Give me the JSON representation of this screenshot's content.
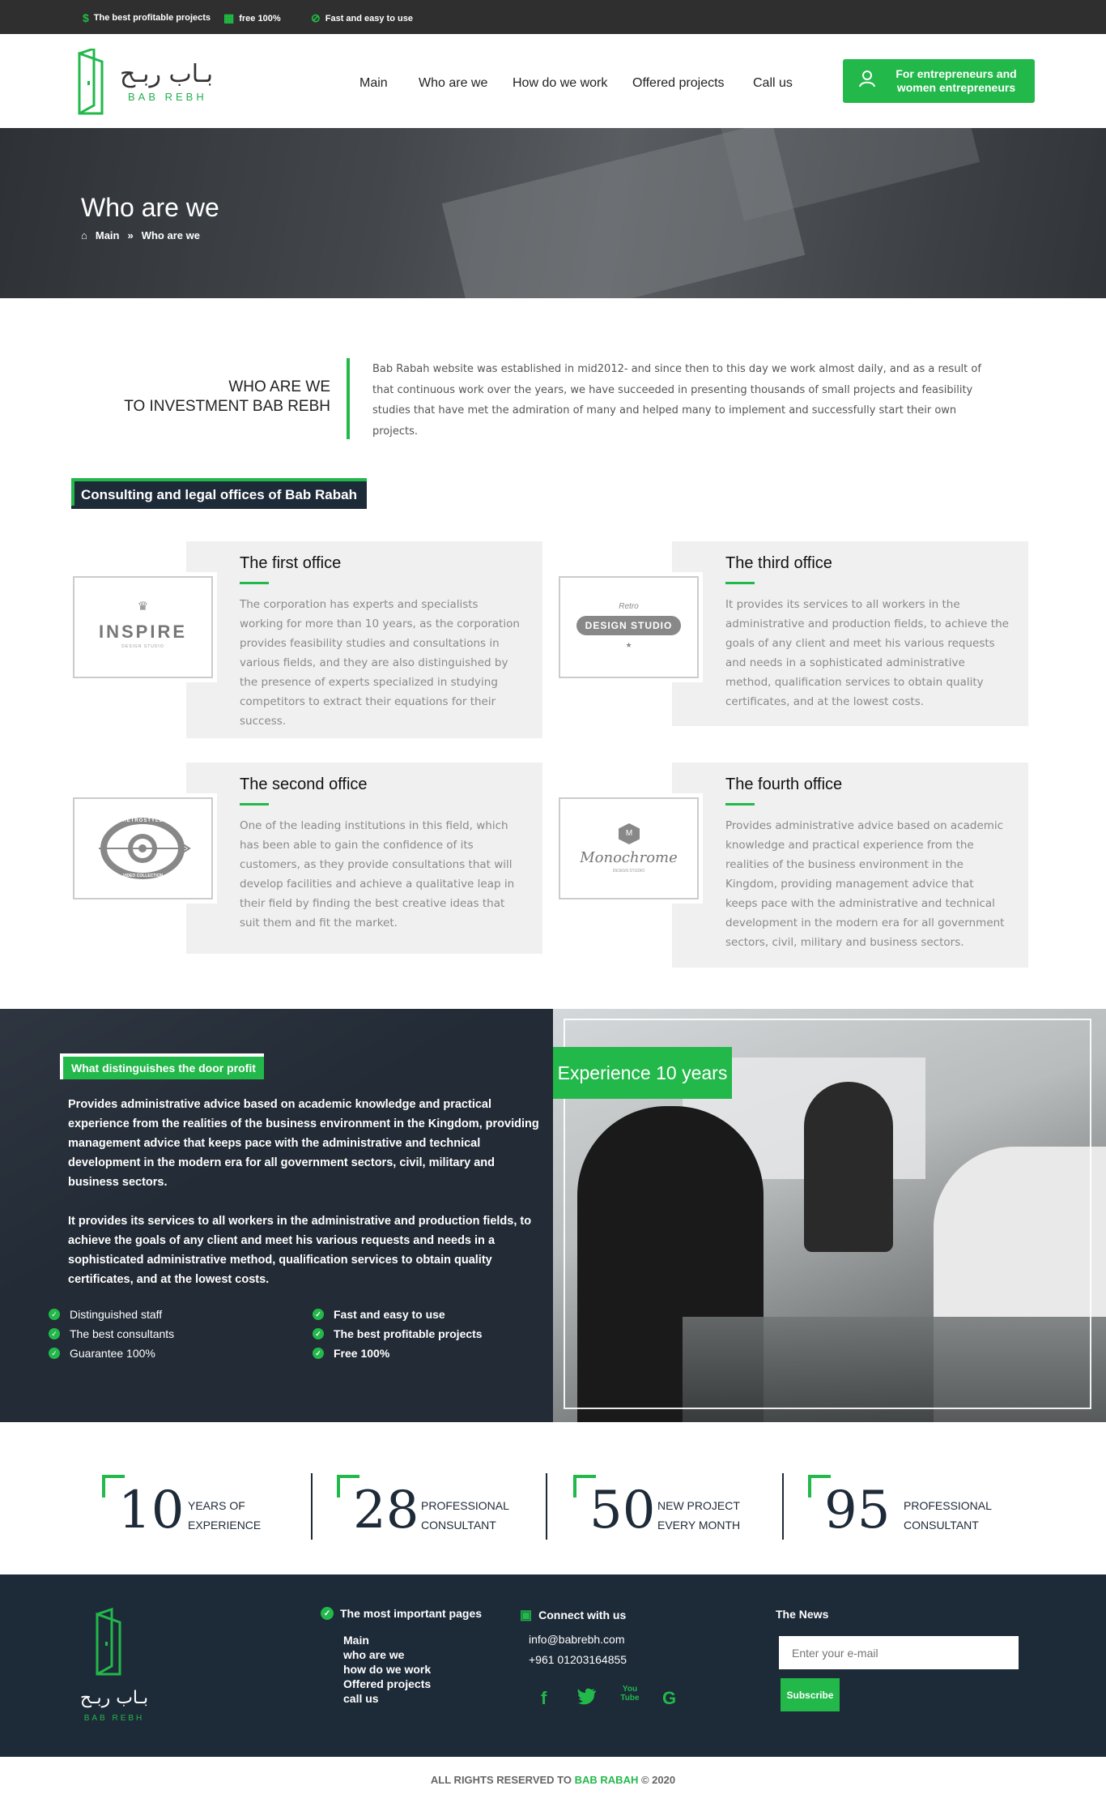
{
  "topbar": {
    "items": [
      {
        "icon": "dollar-icon",
        "label": "The best profitable projects"
      },
      {
        "icon": "chart-icon",
        "label": "free 100%"
      },
      {
        "icon": "check-circle-icon",
        "label": "Fast and easy to use"
      }
    ]
  },
  "header": {
    "logo_ar": "بـاب ربـح",
    "logo_en": "BAB REBH",
    "nav": [
      "Main",
      "Who are we",
      "How do we work",
      "Offered projects",
      "Call us"
    ],
    "cta_line1": "For entrepreneurs and",
    "cta_line2": "women entrepreneurs"
  },
  "hero": {
    "title": "Who are we",
    "crumb_home": "Main",
    "crumb_current": "Who are we"
  },
  "who": {
    "title_line1": "WHO ARE WE",
    "title_line2": "TO INVESTMENT BAB REBH",
    "text": "Bab Rabah website was established in mid2012- and since then to this day we work almost daily, and as a result of that continuous work over the years, we have succeeded in presenting thousands of small projects and feasibility studies that have met the admiration of many and helped many to implement and successfully start their own projects."
  },
  "offices": {
    "badge": "Consulting and legal offices of Bab Rabah",
    "items": [
      {
        "title": "The first office",
        "logo": "INSPIRE",
        "logo_sub": "DESIGN STUDIO",
        "text": "The corporation has experts and specialists working for more than 10 years, as the corporation provides feasibility studies and consultations in various fields, and they are also distinguished by the presence of experts specialized in studying competitors to extract their equations for their success."
      },
      {
        "title": "The third office",
        "logo": "DESIGN STUDIO",
        "logo_sub": "Retro",
        "text": "It provides its services to all workers in the administrative and production fields, to achieve the goals of any client and meet his various requests and needs in a sophisticated administrative method, qualification services to obtain quality certificates, and at the lowest costs."
      },
      {
        "title": "The second office",
        "logo": "RETROSTYLE",
        "logo_sub": "VIDEO COLLECTION",
        "text": "One of the leading institutions in this field, which has been able to gain the confidence of its customers, as they provide consultations that will develop facilities and achieve a qualitative leap in their field by finding the best creative ideas that suit them and fit the market."
      },
      {
        "title": "The fourth  office",
        "logo": "Monochrome",
        "logo_sub": "DESIGN STUDIO",
        "text": "Provides administrative advice based on academic knowledge and practical experience from the realities of the business environment in the Kingdom, providing management advice that keeps pace with the administrative and technical development in the modern era for all government sectors, civil, military and business sectors."
      }
    ]
  },
  "distinguish": {
    "tag": "What distinguishes the door profit",
    "para1": "Provides administrative advice based on academic knowledge and practical experience from the realities of the business environment in the Kingdom, providing management advice that keeps pace with the administrative and technical development in the modern era for all government sectors, civil, military and business sectors.",
    "para2": "It provides its services to all workers in the administrative and production fields, to achieve the goals of any client and meet his various requests and needs in a sophisticated administrative method, qualification services to obtain quality certificates, and at the lowest costs.",
    "left_checks": [
      "Distinguished staff",
      "The best consultants",
      "Guarantee 100%"
    ],
    "right_checks": [
      "Fast and easy to use",
      "The best profitable projects",
      "Free 100%"
    ],
    "experience": "Experience 10 years"
  },
  "stats": [
    {
      "num": "10",
      "l1": "YEARS OF",
      "l2": "EXPERIENCE"
    },
    {
      "num": "28",
      "l1": "PROFESSIONAL",
      "l2": "CONSULTANT"
    },
    {
      "num": "50",
      "l1": "NEW PROJECT",
      "l2": "EVERY MONTH"
    },
    {
      "num": "95",
      "l1": "PROFESSIONAL",
      "l2": "CONSULTANT"
    }
  ],
  "footer": {
    "logo_ar": "بـاب ربـح",
    "logo_en": "BAB REBH",
    "pages_title": "The most important pages",
    "pages": [
      "Main",
      "who are we",
      "how do we work",
      "Offered projects",
      "call us"
    ],
    "connect_title": "Connect with us",
    "email": "info@babrebh.com",
    "phone": "+961 01203164855",
    "social": [
      "f",
      "t",
      "You Tube",
      "G"
    ],
    "news_title": "The News",
    "email_placeholder": "Enter your e-mail",
    "subscribe": "Subscribe"
  },
  "copyright": {
    "prefix": "ALL RIGHTS RESERVED TO",
    "brand": "BAB RABAH",
    "suffix": "© 2020"
  },
  "colors": {
    "green": "#22b84a",
    "navy": "#1d2a38",
    "dark": "#2f2f2f"
  }
}
